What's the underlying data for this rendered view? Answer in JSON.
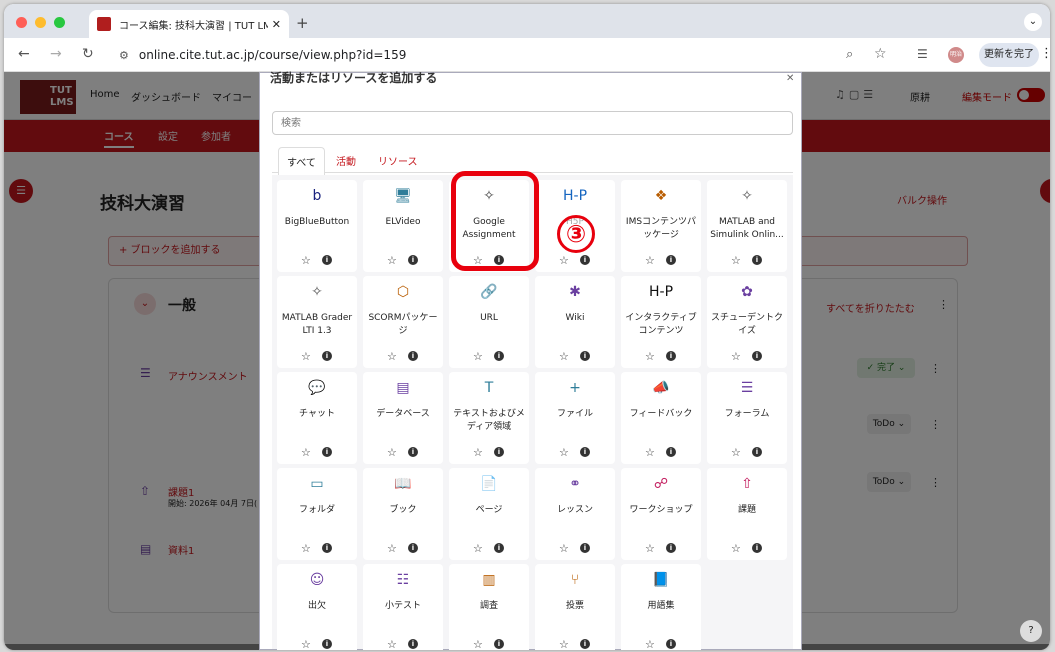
{
  "browser": {
    "tab_title": "コース編集: 技科大演習 | TUT LM",
    "url": "online.cite.tut.ac.jp/course/view.php?id=159",
    "update_button": "更新を完了",
    "profile_label": "明治",
    "colors": {
      "close": "#ff5f57",
      "minimize": "#febc2e",
      "maximize": "#28c840"
    }
  },
  "lms": {
    "logo_text": "TUT LMS",
    "nav": {
      "home": "Home",
      "dashboard": "ダッシュボード",
      "my": "マイコー"
    },
    "user_name": "原耕",
    "edit_mode": "編集モード",
    "secondary": {
      "course": "コース",
      "settings": "設定",
      "participants": "参加者"
    },
    "course_title": "技科大演習",
    "bulk_edit": "バルク操作",
    "add_block": "+ ブロックを追加する",
    "section_title": "一般",
    "collapse_all": "すべてを折りたたむ",
    "activities": {
      "announcement": "アナウンスメント",
      "assignment": "課題1",
      "assignment_due": "開始: 2026年 04月 7日(",
      "resource": "資料1"
    },
    "done_label": "✓ 完了 ⌄",
    "todo_label": "ToDo ⌄",
    "help": "?",
    "accent_color": "#c4161c"
  },
  "modal": {
    "title": "活動またはリソースを追加する",
    "search_placeholder": "検索",
    "tabs": {
      "all": "すべて",
      "activity": "活動",
      "resource": "リソース"
    },
    "items": [
      {
        "label": "BigBlueButton",
        "icon": "b"
      },
      {
        "label": "ELVideo",
        "icon": "🖥"
      },
      {
        "label": "Google Assignment",
        "icon": "✧"
      },
      {
        "label": "H5P",
        "icon": "H-P"
      },
      {
        "label": "IMSコンテンツパッケージ",
        "icon": "❖"
      },
      {
        "label": "MATLAB and Simulink Onlin...",
        "icon": "✧"
      },
      {
        "label": "MATLAB Grader LTI 1.3",
        "icon": "✧"
      },
      {
        "label": "SCORMパッケージ",
        "icon": "⬡"
      },
      {
        "label": "URL",
        "icon": "🔗"
      },
      {
        "label": "Wiki",
        "icon": "✱"
      },
      {
        "label": "インタラクティブコンテンツ",
        "icon": "H-P"
      },
      {
        "label": "スチューデントクイズ",
        "icon": "✿"
      },
      {
        "label": "チャット",
        "icon": "💬"
      },
      {
        "label": "データベース",
        "icon": "▤"
      },
      {
        "label": "テキストおよびメディア領域",
        "icon": "T"
      },
      {
        "label": "ファイル",
        "icon": "+"
      },
      {
        "label": "フィードバック",
        "icon": "📣"
      },
      {
        "label": "フォーラム",
        "icon": "☰"
      },
      {
        "label": "フォルダ",
        "icon": "▭"
      },
      {
        "label": "ブック",
        "icon": "📖"
      },
      {
        "label": "ページ",
        "icon": "📄"
      },
      {
        "label": "レッスン",
        "icon": "⚭"
      },
      {
        "label": "ワークショップ",
        "icon": "☍"
      },
      {
        "label": "課題",
        "icon": "⇧"
      },
      {
        "label": "出欠",
        "icon": "☺"
      },
      {
        "label": "小テスト",
        "icon": "☷"
      },
      {
        "label": "調査",
        "icon": "▥"
      },
      {
        "label": "投票",
        "icon": "⑂"
      },
      {
        "label": "用語集",
        "icon": "📘"
      }
    ],
    "star": "☆",
    "info": "i"
  },
  "annotation": {
    "step_number": "③",
    "color": "#e8000d"
  }
}
